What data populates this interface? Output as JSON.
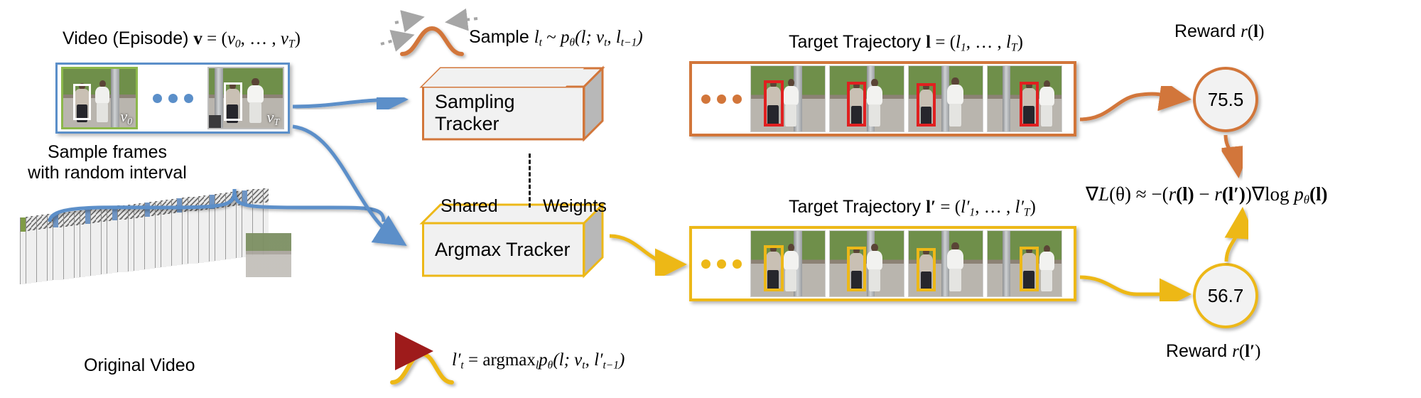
{
  "colors": {
    "blue": "#5b8fc9",
    "orange": "#d2763a",
    "yellow": "#edb818",
    "red_arrow": "#9e1b1b",
    "gray_arrow": "#a6a6a6",
    "box_fill": "#f1f1f1",
    "box_side": "#b8b8b8"
  },
  "video_panel": {
    "title_parts": {
      "plain": "Video (Episode) ",
      "bold_v": "v",
      "eq": " = (",
      "v0": "v",
      "v0_sub": "0",
      "mid": ", … , ",
      "vT": "v",
      "vT_sub": "T",
      "close": ")"
    },
    "frames": [
      {
        "caption": "v",
        "caption_sub": "0",
        "accent": "#8cb84b"
      },
      {
        "caption": "v",
        "caption_sub": "T",
        "accent": "#b0b0b0"
      }
    ],
    "ellipsis_color": "#5b8fc9"
  },
  "left_caption": {
    "line1": "Sample frames",
    "line2": "with random interval"
  },
  "original_video": {
    "label": "Original Video"
  },
  "sample_note": {
    "prefix": "Sample ",
    "l": "l",
    "l_sub": "t",
    "sim": " ~ ",
    "p": "p",
    "theta": "θ",
    "args": "(l; v",
    "args_sub1": "t",
    "args_mid": ", l",
    "args_sub2": "t−1",
    "args_close": ")"
  },
  "argmax_note": {
    "lhs": "l",
    "lhs_prime": "′",
    "lhs_sub": "t",
    "eq": " = ",
    "argmax": "argmax",
    "argmax_sub": "l",
    "p": "p",
    "theta": "θ",
    "args": "(l; v",
    "args_sub1": "t",
    "args_mid": ", l",
    "args_prime2": "′",
    "args_sub2": "t−1",
    "args_close": ")"
  },
  "trackers": {
    "sampling": {
      "label": "Sampling Tracker",
      "accent": "#d2763a"
    },
    "argmax": {
      "label": "Argmax Tracker",
      "accent": "#edb818"
    },
    "shared_left": "Shared",
    "shared_right": "Weights"
  },
  "trajectory_top": {
    "title_plain": "Target Trajectory ",
    "title_bold": "l",
    "title_eq": " = (",
    "title_l1": "l",
    "title_l1_sub": "1",
    "title_mid": ", … , ",
    "title_lT": "l",
    "title_lT_sub": "T",
    "title_close": ")",
    "accent": "#d2763a",
    "bbox_color": "#e02020",
    "frame_count": 4
  },
  "trajectory_bottom": {
    "title_plain": "Target Trajectory ",
    "title_bold": "l",
    "title_prime": "′",
    "title_eq": " = (",
    "title_l1": "l",
    "title_l1_prime": "′",
    "title_l1_sub": "1",
    "title_mid": ", … , ",
    "title_lT": "l",
    "title_lT_prime": "′",
    "title_lT_sub": "T",
    "title_close": ")",
    "accent": "#edb818",
    "bbox_color": "#edb818",
    "frame_count": 4
  },
  "reward_top": {
    "label_plain": "Reward ",
    "label_r": "r",
    "label_arg_open": "(",
    "label_bold_l": "l",
    "label_arg_close": ")",
    "value": "75.5",
    "accent": "#d2763a"
  },
  "reward_bottom": {
    "label_plain": "Reward ",
    "label_r": "r",
    "label_arg_open": "(",
    "label_bold_l": "l",
    "label_prime": "′",
    "label_arg_close": ")",
    "value": "56.7",
    "accent": "#edb818"
  },
  "gradient_formula": {
    "nabla": "∇",
    "L": "L",
    "theta_open": "(θ) ",
    "approx": "≈ ",
    "minus": "−(",
    "r1": "r",
    "b1": "(l)",
    "mid": " − ",
    "r2": "r",
    "b2": "(l′)",
    "close": ")",
    "nabla2": "∇",
    "log": "log ",
    "p": "p",
    "theta2": "θ",
    "bl": "(l)"
  }
}
